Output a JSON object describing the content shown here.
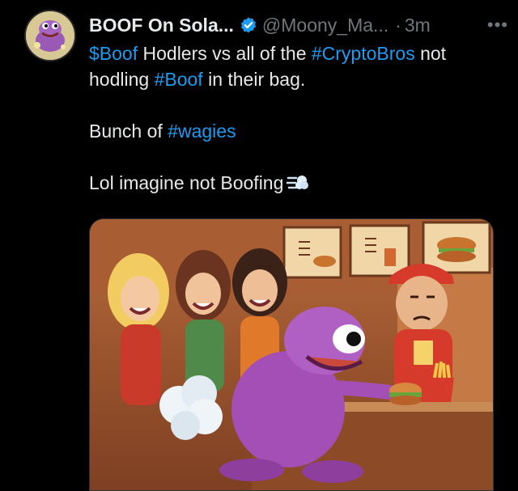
{
  "author": {
    "display_name": "BOOF On Sola...",
    "handle": "@Moony_Ma...",
    "separator": "·",
    "time": "3m",
    "more_label": "•••",
    "verified": true
  },
  "tweet": {
    "line1": {
      "cashtag": "$Boof",
      "text1": " Hodlers vs all of the ",
      "hashtag1": "#CryptoBros",
      "text2": " not"
    },
    "line2": {
      "text1": "hodling ",
      "hashtag": "#Boof",
      "text2": " in their bag."
    },
    "line3": {
      "text1": "Bunch of ",
      "hashtag": "#wagies"
    },
    "line4": {
      "text1": "Lol imagine not Boofing",
      "emoji": "dashing-away-emoji"
    }
  },
  "colors": {
    "background": "#000000",
    "text": "#e7e9ea",
    "secondary": "#71767b",
    "link": "#1d9bf0",
    "verified": "#1d9bf0"
  },
  "media": {
    "menu_board_icons": [
      "burger-icon",
      "fries-icon",
      "drink-icon",
      "burger-icon"
    ]
  }
}
